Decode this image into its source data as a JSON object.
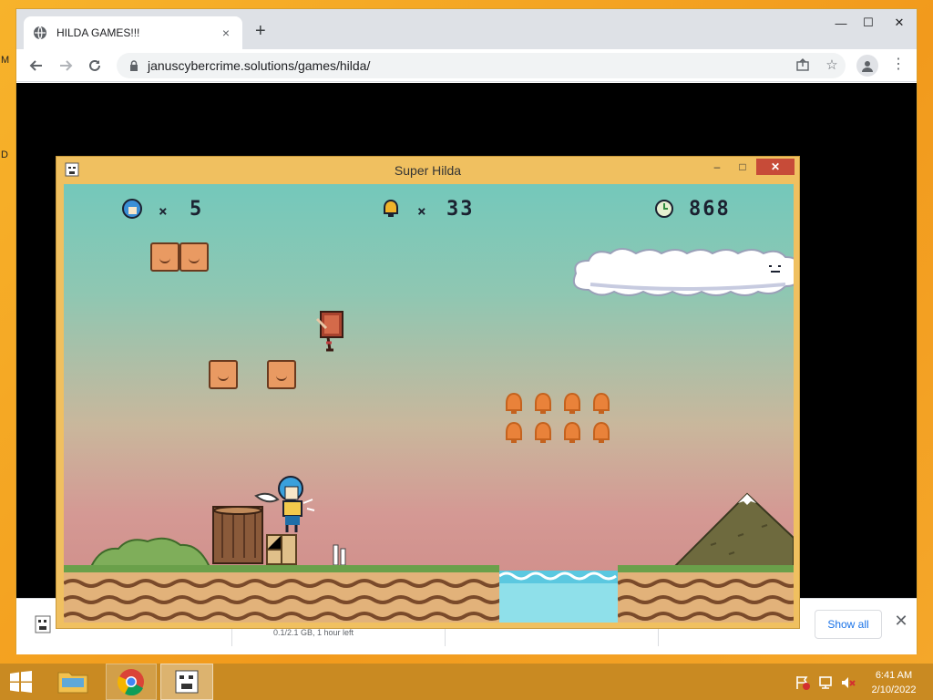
{
  "desktop": {
    "strip_letters": [
      "M",
      "D"
    ]
  },
  "browser": {
    "tab_title": "HILDA GAMES!!!",
    "tab_close": "×",
    "new_tab": "+",
    "url": "januscybercrime.solutions/games/hilda/",
    "window_controls": {
      "minimize": "—",
      "maximize": "☐",
      "close": "✕"
    }
  },
  "downloads": {
    "status": "0.1/2.1 GB, 1 hour left",
    "show_all_label": "Show all",
    "close": "✕"
  },
  "game_window": {
    "title": "Super Hilda",
    "controls": {
      "minimize": "–",
      "maximize": "□",
      "close": "✕"
    },
    "hud": {
      "lives": "5",
      "bells": "33",
      "timer": "868",
      "times_sign": "×"
    }
  },
  "taskbar": {
    "time": "6:41 AM",
    "date": "2/10/2022"
  },
  "colors": {
    "desktop": "#f5a623",
    "game_frame": "#f0c060",
    "sky_top": "#74c8bb",
    "sky_bottom": "#cf8a86",
    "block": "#e99a62",
    "bell": "#e9823a",
    "water": "#8fe0ea"
  }
}
